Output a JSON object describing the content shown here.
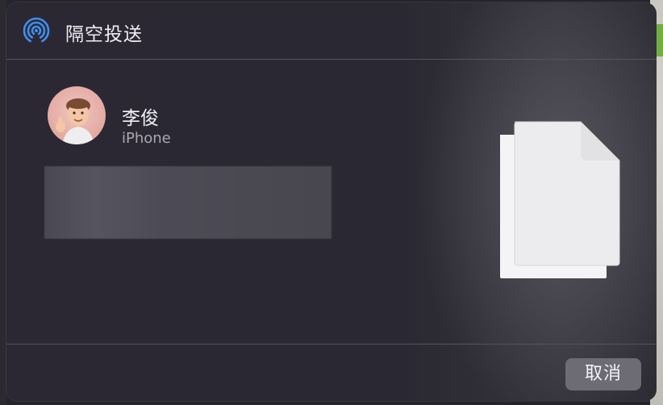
{
  "dialog": {
    "title": "隔空投送",
    "icon": "airdrop-icon",
    "accent_color": "#3f8ef0"
  },
  "recipient": {
    "name": "李俊",
    "device": "iPhone",
    "avatar": "memoji-avatar"
  },
  "file_preview": {
    "icon": "document-stack-icon"
  },
  "actions": {
    "cancel_label": "取消"
  }
}
